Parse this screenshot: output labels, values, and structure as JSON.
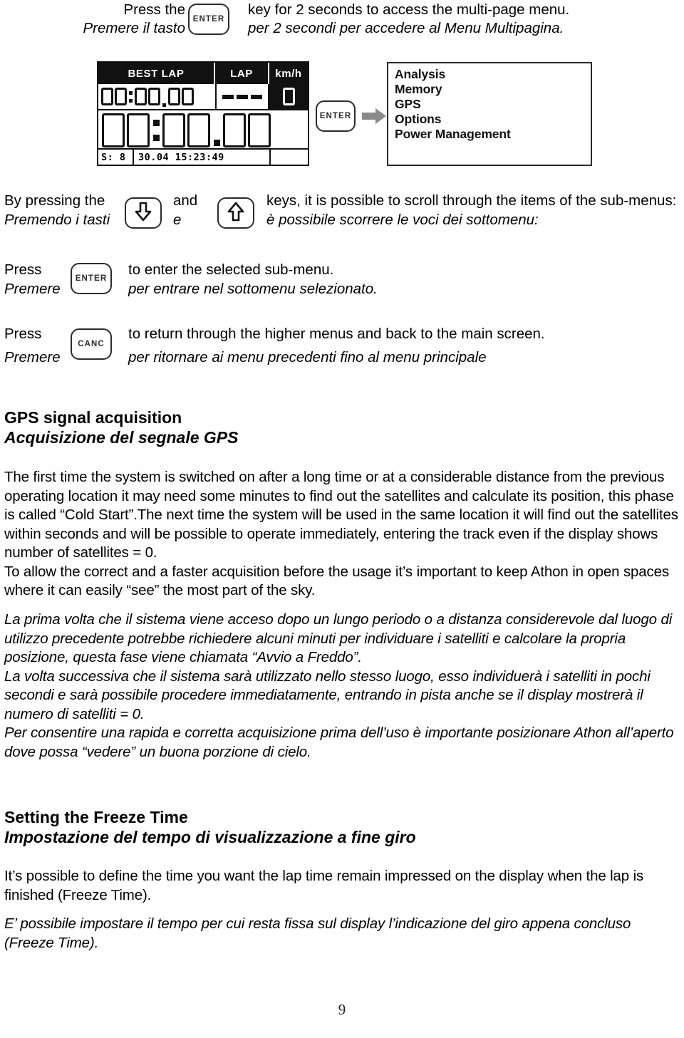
{
  "page": {
    "number": "9"
  },
  "top_instruction": {
    "en_label": "Press the",
    "it_label": "Premere il tasto",
    "en_text": "key for 2 seconds to access the multi-page menu.",
    "it_text": "per 2 secondi per accedere al Menu Multipagina.",
    "key_label": "ENTER"
  },
  "display": {
    "header": {
      "best_lap": "BEST LAP",
      "lap": "LAP",
      "speed_unit": "km/h"
    },
    "best_lap_value": "00:00.00",
    "lap_value": "---",
    "main_time": "00:00.00",
    "status_bar": {
      "satellites": "S:  8",
      "date_time": "30.04  15:23:49",
      "extra": ""
    }
  },
  "menu": {
    "key_label": "ENTER",
    "items": [
      "Analysis",
      "Memory",
      "GPS",
      "Options",
      "Power Management"
    ]
  },
  "scroll_instruction": {
    "en_label": "By pressing the",
    "it_label": "Premendo i tasti",
    "en_conj": "and",
    "it_conj": "e",
    "en_text": "keys, it is possible to scroll through the items of the sub-menus:",
    "it_text": "è possibile scorrere le voci dei sottomenu:",
    "key_down": "arrow-down",
    "key_up": "arrow-up"
  },
  "enter_instruction": {
    "en_label": "Press",
    "it_label": "Premere",
    "key_label": "ENTER",
    "en_text": "to enter the selected sub-menu.",
    "it_text": "per entrare nel sottomenu selezionato."
  },
  "canc_instruction": {
    "en_label": "Press",
    "it_label": "Premere",
    "key_label": "CANC",
    "en_text": "to return through the higher menus and back to the main screen.",
    "it_text": "per ritornare ai menu precedenti fino al menu principale"
  },
  "gps_section": {
    "heading_en": "GPS signal acquisition",
    "heading_it": "Acquisizione del segnale GPS",
    "para_en_1": "The first time the system is switched on after a long time or at a considerable distance from the previous operating location it may need some minutes to find out the satellites and calculate its position, this phase is called “Cold Start”.The next time the system will be used in the same location it will find out the satellites within seconds and will be possible to operate immediately, entering the track even if the display shows number of satellites = 0.",
    "para_en_2": "To allow the correct and a faster acquisition before the usage it’s important to keep Athon in open spaces where it can easily “see” the most part of the sky.",
    "para_it_1": "La prima volta che il sistema viene acceso dopo un lungo periodo o a distanza considerevole dal luogo di utilizzo precedente potrebbe richiedere alcuni minuti per individuare i satelliti e calcolare la propria posizione, questa fase viene chiamata “Avvio a Freddo”.",
    "para_it_2": "La volta successiva che il sistema sarà utilizzato nello stesso luogo, esso individuerà i satelliti in pochi secondi e sarà possibile procedere immediatamente, entrando in pista anche se il display mostrerà il numero di satelliti = 0.",
    "para_it_3": "Per consentire una rapida e corretta acquisizione prima dell’uso è importante posizionare Athon all’aperto dove possa “vedere” un buona porzione di cielo."
  },
  "freeze_section": {
    "heading_en": "Setting the Freeze Time",
    "heading_it": "Impostazione del tempo di visualizzazione a fine giro",
    "para_en": "It’s possible to define the time you want the lap time remain impressed on the display when the lap is finished (Freeze Time).",
    "para_it": "E’ possibile impostare il tempo per cui resta fissa sul display l’indicazione del giro appena concluso (Freeze Time)."
  }
}
